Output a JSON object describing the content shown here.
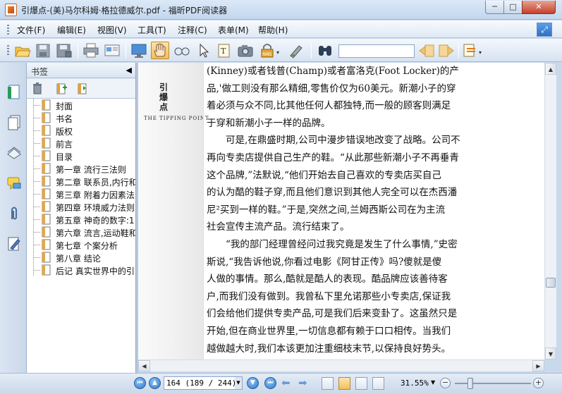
{
  "window": {
    "title": "引爆点-(美)马尔科姆·格拉德威尔.pdf - 福昕PDF阅读器",
    "min_glyph": "─",
    "max_glyph": "□",
    "close_glyph": "✕"
  },
  "menu": {
    "items": [
      "文件(F)",
      "编辑(E)",
      "视图(V)",
      "工具(T)",
      "注释(C)",
      "表单(M)",
      "帮助(H)"
    ]
  },
  "toolbar": {
    "search_value": ""
  },
  "bookmarks": {
    "title": "书签",
    "collapse_glyph": "◀",
    "items": [
      "封面",
      "书名",
      "版权",
      "前言",
      "目录",
      "第一章 流行三法则",
      "第二章 联系员,内行和",
      "第三章 附着力因素法",
      "第四章 环境威力法则",
      "第五章 神奇的数字:1",
      "第六章 流言,运动鞋和",
      "第七章 个案分析",
      "第八章 结论",
      "后记 真实世界中的引"
    ]
  },
  "document": {
    "running_title": "引爆点",
    "running_subtitle": "THE TIPPING POINT",
    "lines": [
      "(Kinney)或者钱普(Champ)或者富洛克(Foot Locker)的产",
      "品,'做工则没有那么精细,零售价仅为60美元。新潮小子的穿",
      "着必须与众不同,比其他任何人都独特,而一般的顾客则满足",
      "于穿和新潮小子一样的品牌。",
      "　　可是,在鼎盛时期,公司中漫步错误地改变了战略。公司不",
      "再向专卖店提供自己生产的鞋。“从此那些新潮小子不再垂青",
      "这个品牌,”法默说,“他们开始去自己喜欢的专卖店买自己",
      "的认为酷的鞋子穿,而且他们意识到其他人完全可以在杰西潘",
      "尼²买到一样的鞋。”于是,突然之间,兰姆西斯公司在为主流",
      "社会宣传主流产品。流行结束了。",
      "　　“我的部门经理曾经问过我究竟是发生了什么事情,”史密",
      "斯说,“我告诉他说,你看过电影《阿甘正传》吗?傻就是傻",
      "人做的事情。那么,酷就是酷人的表现。酷品牌应该善待客",
      "户,而我们没有做到。我曾私下里允诺那些小专卖店,保证我",
      "们会给他们提供专卖产品,可是我们后来变卦了。这虽然只是",
      "开始,但在商业世界里,一切信息都有赖于口口相传。当我们",
      "越做越大时,我们本该更加注重细枝末节,以保持良好势头。"
    ]
  },
  "status": {
    "page_display": "164 (189 / 244)",
    "zoom": "31.55%",
    "zoom_level_percent": 20
  },
  "colors": {
    "accent": "#2c77c9",
    "titlebar": "#c3d7ef",
    "active_tool": "#f2bd57"
  }
}
